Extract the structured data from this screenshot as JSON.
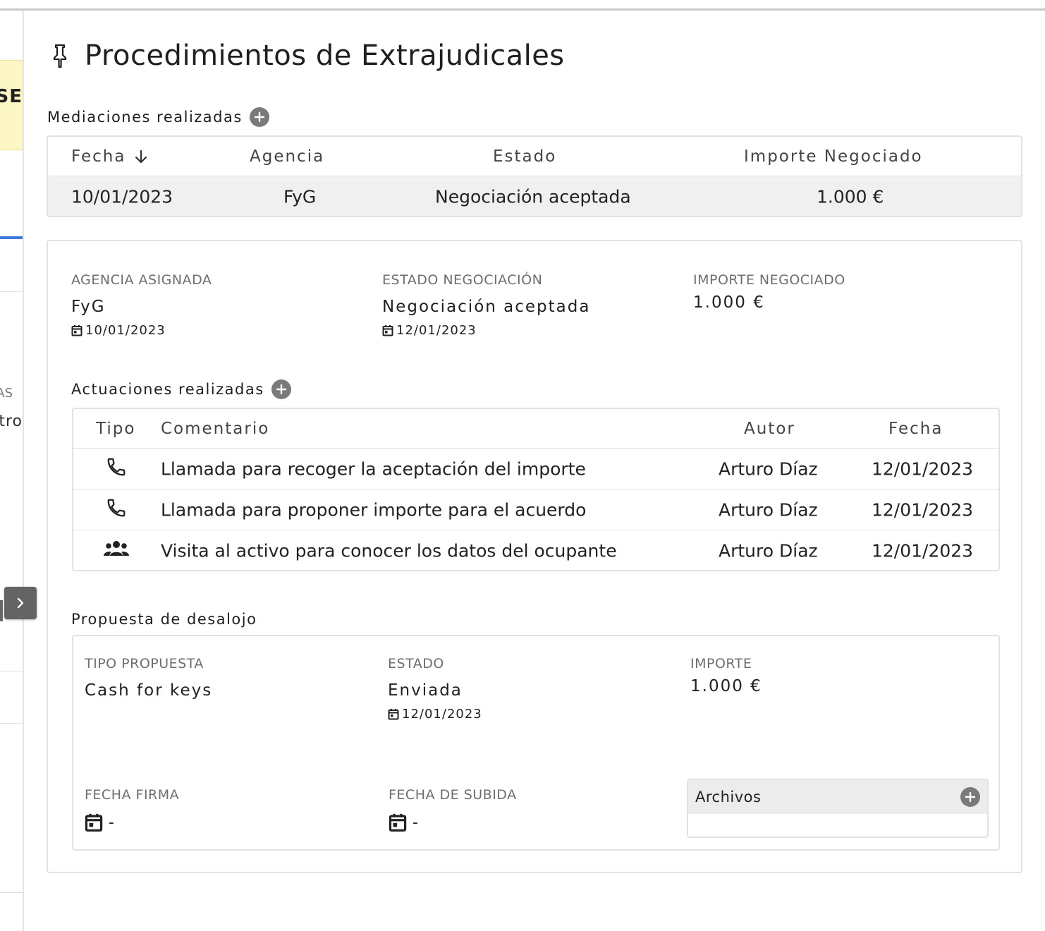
{
  "sidebar": {
    "truncated_badge": "SE",
    "truncated_text_1": "AS",
    "truncated_text_2": "tro"
  },
  "page": {
    "title": "Procedimientos de Extrajudicales",
    "title_icon": "pin-icon"
  },
  "mediaciones": {
    "section_label": "Mediaciones realizadas",
    "columns": [
      "Fecha",
      "Agencia",
      "Estado",
      "Importe Negociado"
    ],
    "sort_icon": "arrow-down-icon",
    "rows": [
      {
        "fecha": "10/01/2023",
        "agencia": "FyG",
        "estado": "Negociación aceptada",
        "importe": "1.000 €"
      }
    ]
  },
  "detalle": {
    "agencia_label": "AGENCIA ASIGNADA",
    "agencia_value": "FyG",
    "agencia_date": "10/01/2023",
    "estado_label": "ESTADO NEGOCIACIÓN",
    "estado_value": "Negociación aceptada",
    "estado_date": "12/01/2023",
    "importe_label": "IMPORTE NEGOCIADO",
    "importe_value": "1.000 €"
  },
  "actuaciones": {
    "section_label": "Actuaciones realizadas",
    "columns": [
      "Tipo",
      "Comentario",
      "Autor",
      "Fecha"
    ],
    "rows": [
      {
        "icon": "phone-icon",
        "comentario": "Llamada para recoger la aceptación del importe",
        "autor": "Arturo Díaz",
        "fecha": "12/01/2023"
      },
      {
        "icon": "phone-icon",
        "comentario": "Llamada para proponer importe para el acuerdo",
        "autor": "Arturo Díaz",
        "fecha": "12/01/2023"
      },
      {
        "icon": "group-icon",
        "comentario": "Visita al activo para conocer los datos del ocupante",
        "autor": "Arturo Díaz",
        "fecha": "12/01/2023"
      }
    ]
  },
  "propuesta": {
    "section_label": "Propuesta de desalojo",
    "tipo_label": "TIPO PROPUESTA",
    "tipo_value": "Cash for keys",
    "estado_label": "ESTADO",
    "estado_value": "Enviada",
    "estado_date": "12/01/2023",
    "importe_label": "IMPORTE",
    "importe_value": "1.000 €",
    "firma_label": "FECHA FIRMA",
    "firma_value": "-",
    "subida_label": "FECHA DE SUBIDA",
    "subida_value": "-",
    "archivos_label": "Archivos"
  },
  "colors": {
    "accent_blue": "#3b7be0",
    "highlight_yellow": "#fdf6c5",
    "row_bg": "#f0f0f0",
    "border": "#e2e2e2",
    "icon_gray": "#7a7a7a"
  }
}
